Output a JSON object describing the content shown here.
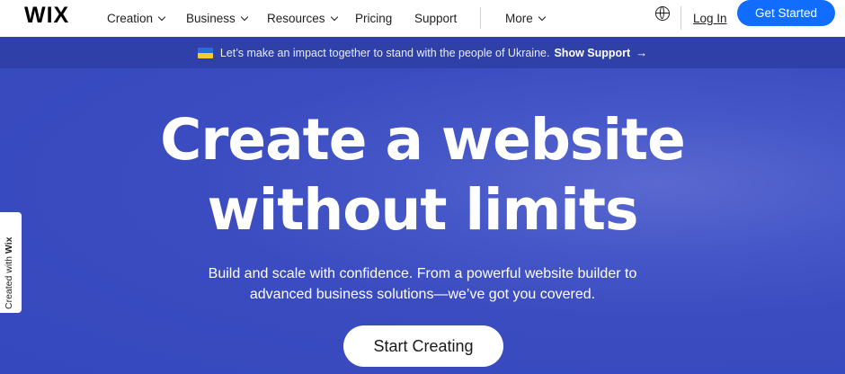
{
  "header": {
    "logo": "WIX",
    "nav": [
      "Creation",
      "Business",
      "Resources",
      "Pricing",
      "Support",
      "More"
    ],
    "login": "Log In",
    "cta": "Get Started"
  },
  "banner": {
    "text": "Let’s make an impact together to stand with the people of Ukraine.",
    "link": "Show Support",
    "arrow": "→"
  },
  "hero": {
    "headline_line1": "Create a website",
    "headline_line2": "without limits",
    "sub_line1": "Build and scale with confidence. From a powerful website builder to",
    "sub_line2": "advanced business solutions—we’ve got you covered.",
    "button": "Start Creating"
  },
  "sidetab": {
    "prefix": "Created with",
    "brand": "Wix"
  },
  "colors": {
    "primary": "#116dff",
    "hero_bg": "#3a4fc1",
    "banner_bg": "#2f41a8"
  }
}
